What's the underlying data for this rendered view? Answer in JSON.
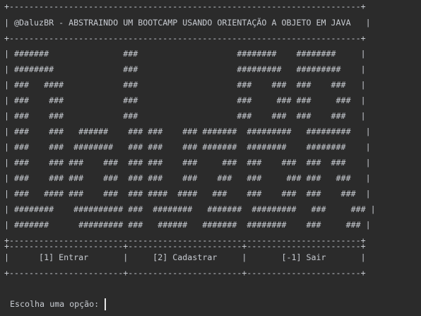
{
  "terminal": {
    "lines": [
      "+-----------------------------------------------------------------------+",
      "| @DaluzBR - ABSTRAINDO UM BOOTCAMP USANDO ORIENTAÇÃO A OBJETO EM JAVA   |",
      "+-----------------------------------------------------------------------+",
      "| #######               ###                    ########    ########     |",
      "| ########              ###                    #########   #########    |",
      "| ###   ####            ###                    ###    ###  ###    ###   |",
      "| ###    ###            ###                    ###     ### ###     ###  |",
      "| ###    ###            ###                    ###    ###  ###    ###   |",
      "| ###    ###   ######    ### ###    ### #######  #########   #########   |",
      "| ###    ###  ########   ### ###    ### #######  ########    ########    |",
      "| ###    ### ###    ###  ### ###    ###     ###  ###    ###  ###  ###    |",
      "| ###    ### ###    ###  ### ###    ###    ###   ###     ### ###   ###   |",
      "| ###   #### ###    ###  ### ####  ####   ###    ###    ###  ###    ###  |",
      "| ########    ########## ###  ########   #######  #########   ###     ### |",
      "| #######      ######### ###   ######   #######  ########    ###     ### |",
      "+-----------------------------------------------------------------------+",
      "+-----------------------+-----------------------+-----------------------+",
      "|      [1] Entrar       |     [2] Cadastrar     |       [-1] Sair       |",
      "+-----------------------+-----------------------+-----------------------+"
    ],
    "prompt": "Escolha uma opção: "
  }
}
